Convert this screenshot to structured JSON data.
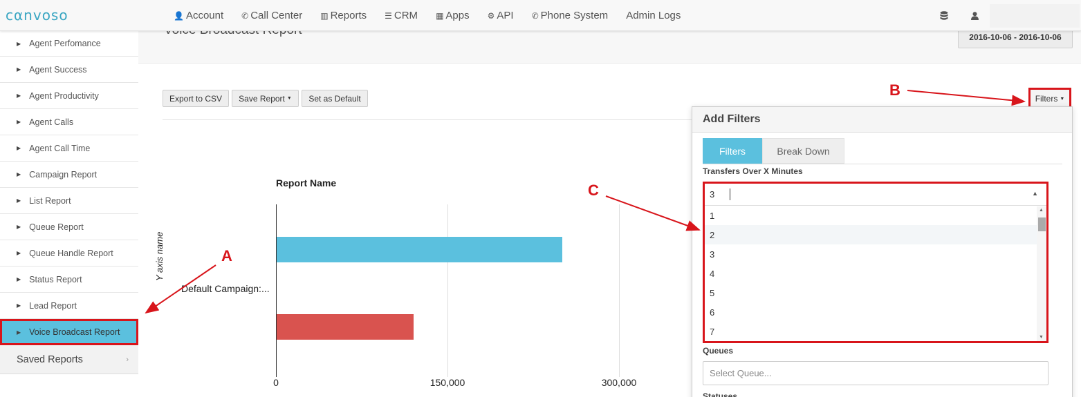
{
  "brand": {
    "logo_text": "cαnvoso"
  },
  "nav": {
    "items": [
      {
        "icon": "user-icon",
        "glyph": "👤",
        "label": "Account"
      },
      {
        "icon": "phone-icon",
        "glyph": "✆",
        "label": "Call Center"
      },
      {
        "icon": "bar-chart-icon",
        "glyph": "▥",
        "label": "Reports"
      },
      {
        "icon": "list-icon",
        "glyph": "☰",
        "label": "CRM"
      },
      {
        "icon": "grid-icon",
        "glyph": "▦",
        "label": "Apps"
      },
      {
        "icon": "gear-icon",
        "glyph": "⚙",
        "label": "API"
      },
      {
        "icon": "phone-icon",
        "glyph": "✆",
        "label": "Phone System"
      },
      {
        "icon": "",
        "glyph": "",
        "label": "Admin Logs"
      }
    ],
    "right_icons": [
      "database-icon",
      "user-icon"
    ]
  },
  "sidebar": {
    "items": [
      {
        "label": "Agent Perfomance"
      },
      {
        "label": "Agent Success"
      },
      {
        "label": "Agent Productivity"
      },
      {
        "label": "Agent Calls"
      },
      {
        "label": "Agent Call Time"
      },
      {
        "label": "Campaign Report"
      },
      {
        "label": "List Report"
      },
      {
        "label": "Queue Report"
      },
      {
        "label": "Queue Handle Report"
      },
      {
        "label": "Status Report"
      },
      {
        "label": "Lead Report"
      },
      {
        "label": "Voice Broadcast Report",
        "active": true
      }
    ],
    "saved_reports_label": "Saved Reports"
  },
  "page": {
    "title": "Voice Broadcast Report",
    "date_range": "2016-10-06 - 2016-10-06"
  },
  "toolbar": {
    "export_label": "Export to CSV",
    "save_label": "Save Report",
    "default_label": "Set as Default",
    "filters_label": "Filters"
  },
  "chart_data": {
    "type": "bar",
    "orientation": "horizontal",
    "title": "Report Name",
    "ylabel": "Y axis name",
    "categories": [
      "Default Campaign:..."
    ],
    "series": [
      {
        "values": [
          250000
        ],
        "color": "#5bc0de"
      },
      {
        "values": [
          120000
        ],
        "color": "#d9534f"
      }
    ],
    "x_ticks": [
      "0",
      "150,000",
      "300,000"
    ],
    "xlim": [
      0,
      450000
    ],
    "grid": true
  },
  "filters_panel": {
    "title": "Add Filters",
    "tabs": [
      "Filters",
      "Break Down"
    ],
    "transfers_label": "Transfers Over X Minutes",
    "transfers_value": "3",
    "options": [
      "1",
      "2",
      "3",
      "4",
      "5",
      "6",
      "7"
    ],
    "queues_label": "Queues",
    "queue_placeholder": "Select Queue...",
    "statuses_label": "Statuses"
  },
  "annotations": {
    "a": "A",
    "b": "B",
    "c": "C"
  },
  "colors": {
    "accent": "#5bc0de",
    "danger": "#d9534f",
    "annotation": "#d8151b"
  }
}
